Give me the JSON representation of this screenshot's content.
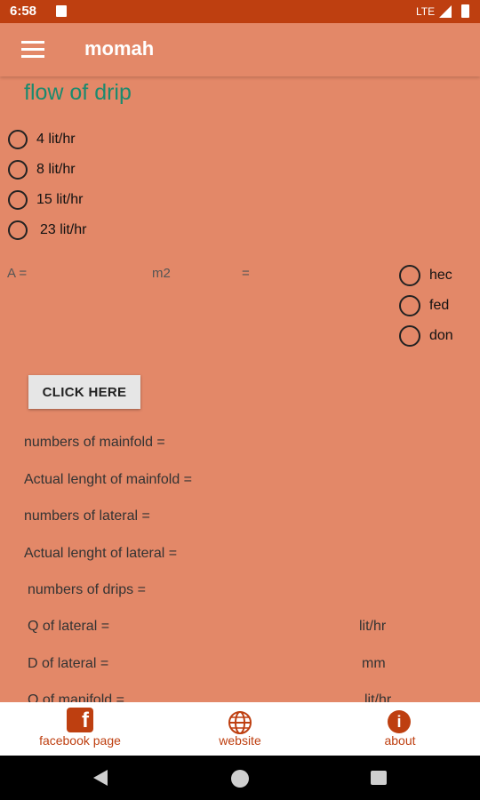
{
  "status_bar": {
    "time": "6:58",
    "network": "LTE"
  },
  "app_bar": {
    "title": "momah"
  },
  "heading": "flow of drip",
  "flow_options": [
    "4 lit/hr",
    "8 lit/hr",
    "15 lit/hr",
    "23 lit/hr"
  ],
  "area": {
    "prefix": "A =",
    "unit": "m2",
    "equals": "="
  },
  "area_units": [
    "hec",
    "fed",
    "don"
  ],
  "button": {
    "label": "CLICK HERE"
  },
  "results": [
    {
      "label": "numbers of mainfold =",
      "unit": ""
    },
    {
      "label": "Actual lenght of mainfold  =",
      "unit": ""
    },
    {
      "label": "numbers of lateral  =",
      "unit": ""
    },
    {
      "label": "Actual lenght of lateral  =",
      "unit": ""
    },
    {
      "label": "numbers of drips  =",
      "unit": ""
    },
    {
      "label": "Q of lateral  =",
      "unit": "lit/hr"
    },
    {
      "label": "D of lateral  =",
      "unit": "mm"
    },
    {
      "label": "Q of manifold  =",
      "unit": "lit/hr"
    }
  ],
  "bottom_nav": [
    {
      "label": "facebook page",
      "icon": "facebook-icon"
    },
    {
      "label": "website",
      "icon": "globe-icon"
    },
    {
      "label": "about",
      "icon": "info-icon"
    }
  ],
  "colors": {
    "background": "#E38868",
    "status_bar": "#BE3F10",
    "accent": "#BE3F10",
    "heading": "#1B8A6E"
  }
}
